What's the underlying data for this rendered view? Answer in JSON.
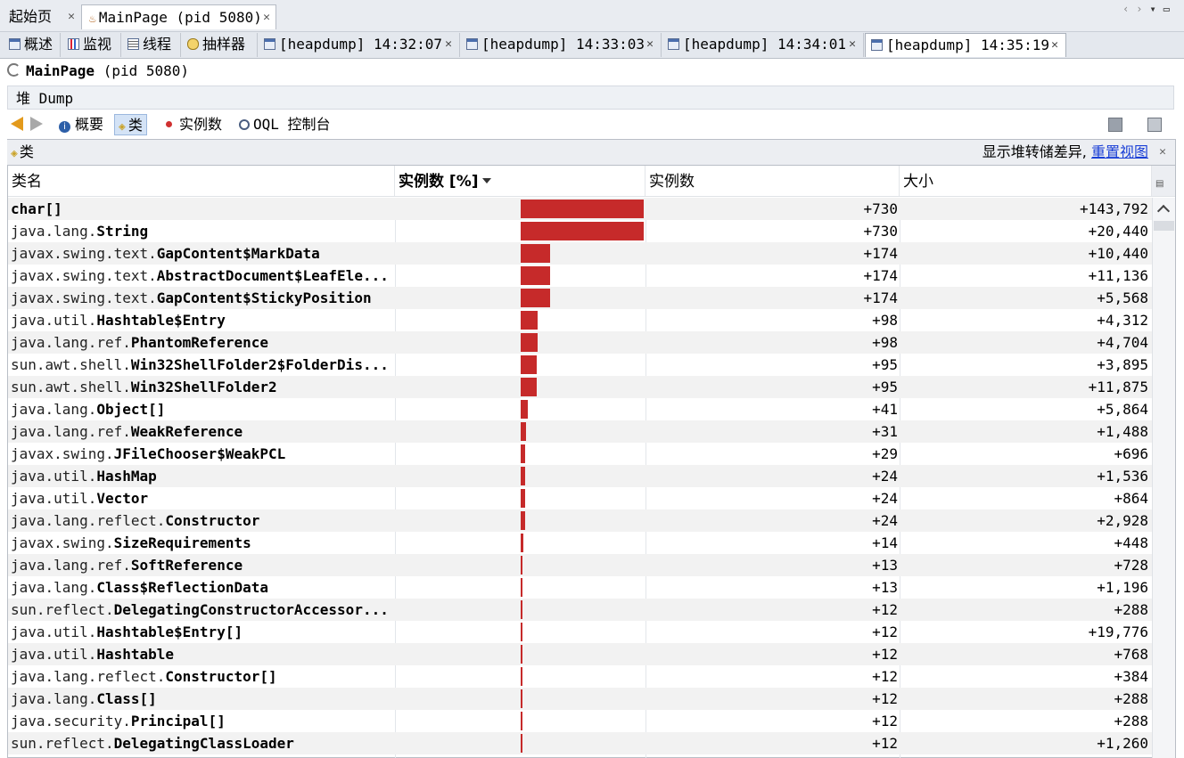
{
  "window_tabs": [
    {
      "label": "起始页"
    },
    {
      "label": "MainPage (pid 5080)"
    }
  ],
  "sub_tabs": [
    {
      "label": "概述",
      "icon": "overview-icon"
    },
    {
      "label": "监视",
      "icon": "monitor-icon"
    },
    {
      "label": "线程",
      "icon": "threads-icon"
    },
    {
      "label": "抽样器",
      "icon": "sampler-icon"
    },
    {
      "label": "[heapdump] 14:32:07",
      "icon": "heapdump-icon"
    },
    {
      "label": "[heapdump] 14:33:03",
      "icon": "heapdump-icon"
    },
    {
      "label": "[heapdump] 14:34:01",
      "icon": "heapdump-icon"
    },
    {
      "label": "[heapdump] 14:35:19",
      "icon": "heapdump-icon",
      "active": true
    }
  ],
  "process": {
    "name": "MainPage",
    "pid": "(pid 5080)"
  },
  "heap_header": "堆 Dump",
  "toolbar": {
    "summary": "概要",
    "classes": "类",
    "instances": "实例数",
    "oql": "OQL 控制台"
  },
  "panel": {
    "title": "类",
    "diff_label": "显示堆转储差异,",
    "reset_view": "重置视图"
  },
  "columns": {
    "name": "类名",
    "pct": "实例数 [%]",
    "count": "实例数",
    "size": "大小"
  },
  "accent_color": "#c62a2a",
  "max_instances": 730,
  "rows": [
    {
      "pkg": "",
      "cls": "char[]",
      "count": "+730",
      "size": "+143,792",
      "n": 730
    },
    {
      "pkg": "java.lang.",
      "cls": "String",
      "count": "+730",
      "size": "+20,440",
      "n": 730
    },
    {
      "pkg": "javax.swing.text.",
      "cls": "GapContent$MarkData",
      "count": "+174",
      "size": "+10,440",
      "n": 174
    },
    {
      "pkg": "javax.swing.text.",
      "cls": "AbstractDocument$LeafEle...",
      "count": "+174",
      "size": "+11,136",
      "n": 174
    },
    {
      "pkg": "javax.swing.text.",
      "cls": "GapContent$StickyPosition",
      "count": "+174",
      "size": "+5,568",
      "n": 174
    },
    {
      "pkg": "java.util.",
      "cls": "Hashtable$Entry",
      "count": "+98",
      "size": "+4,312",
      "n": 98
    },
    {
      "pkg": "java.lang.ref.",
      "cls": "PhantomReference",
      "count": "+98",
      "size": "+4,704",
      "n": 98
    },
    {
      "pkg": "sun.awt.shell.",
      "cls": "Win32ShellFolder2$FolderDis...",
      "count": "+95",
      "size": "+3,895",
      "n": 95
    },
    {
      "pkg": "sun.awt.shell.",
      "cls": "Win32ShellFolder2",
      "count": "+95",
      "size": "+11,875",
      "n": 95
    },
    {
      "pkg": "java.lang.",
      "cls": "Object[]",
      "count": "+41",
      "size": "+5,864",
      "n": 41
    },
    {
      "pkg": "java.lang.ref.",
      "cls": "WeakReference",
      "count": "+31",
      "size": "+1,488",
      "n": 31
    },
    {
      "pkg": "javax.swing.",
      "cls": "JFileChooser$WeakPCL",
      "count": "+29",
      "size": "+696",
      "n": 29
    },
    {
      "pkg": "java.util.",
      "cls": "HashMap",
      "count": "+24",
      "size": "+1,536",
      "n": 24
    },
    {
      "pkg": "java.util.",
      "cls": "Vector",
      "count": "+24",
      "size": "+864",
      "n": 24
    },
    {
      "pkg": "java.lang.reflect.",
      "cls": "Constructor",
      "count": "+24",
      "size": "+2,928",
      "n": 24
    },
    {
      "pkg": "javax.swing.",
      "cls": "SizeRequirements",
      "count": "+14",
      "size": "+448",
      "n": 14
    },
    {
      "pkg": "java.lang.ref.",
      "cls": "SoftReference",
      "count": "+13",
      "size": "+728",
      "n": 13
    },
    {
      "pkg": "java.lang.",
      "cls": "Class$ReflectionData",
      "count": "+13",
      "size": "+1,196",
      "n": 13
    },
    {
      "pkg": "sun.reflect.",
      "cls": "DelegatingConstructorAccessor...",
      "count": "+12",
      "size": "+288",
      "n": 12
    },
    {
      "pkg": "java.util.",
      "cls": "Hashtable$Entry[]",
      "count": "+12",
      "size": "+19,776",
      "n": 12
    },
    {
      "pkg": "java.util.",
      "cls": "Hashtable",
      "count": "+12",
      "size": "+768",
      "n": 12
    },
    {
      "pkg": "java.lang.reflect.",
      "cls": "Constructor[]",
      "count": "+12",
      "size": "+384",
      "n": 12
    },
    {
      "pkg": "java.lang.",
      "cls": "Class[]",
      "count": "+12",
      "size": "+288",
      "n": 12
    },
    {
      "pkg": "java.security.",
      "cls": "Principal[]",
      "count": "+12",
      "size": "+288",
      "n": 12
    },
    {
      "pkg": "sun.reflect.",
      "cls": "DelegatingClassLoader",
      "count": "+12",
      "size": "+1,260",
      "n": 12
    }
  ]
}
